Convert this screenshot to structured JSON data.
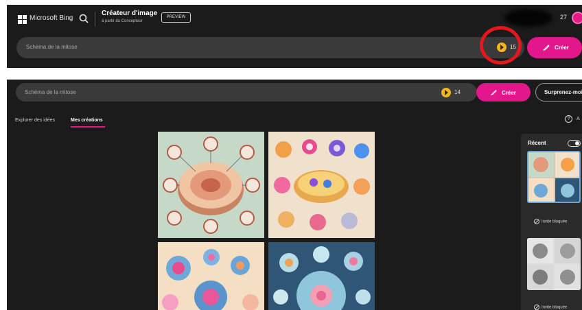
{
  "header": {
    "brand": "Microsoft Bing",
    "app_title": "Créateur d'image",
    "app_subtitle": "à partir du Concepteur",
    "preview_badge": "PREVIEW",
    "reward_count": "27"
  },
  "top_prompt": {
    "text": "Schéma de la mitose",
    "boosts": "15",
    "create_label": "Créer"
  },
  "bottom_prompt": {
    "text": "Schéma de la mitose",
    "boosts": "14",
    "create_label": "Créer",
    "surprise_label": "Surprenez-moi"
  },
  "tabs": [
    {
      "label": "Explorer des idées"
    },
    {
      "label": "Mes créations"
    }
  ],
  "help_label": "A",
  "recent": {
    "title": "Récent",
    "blocked_label_1": "Invite bloquée",
    "blocked_label_2": "Invite bloquée"
  },
  "colors": {
    "accent": "#e2178c",
    "boost_coin": "#f2b51d",
    "highlight_ring": "#e4161e",
    "panel_bg": "#1b1b1b"
  }
}
